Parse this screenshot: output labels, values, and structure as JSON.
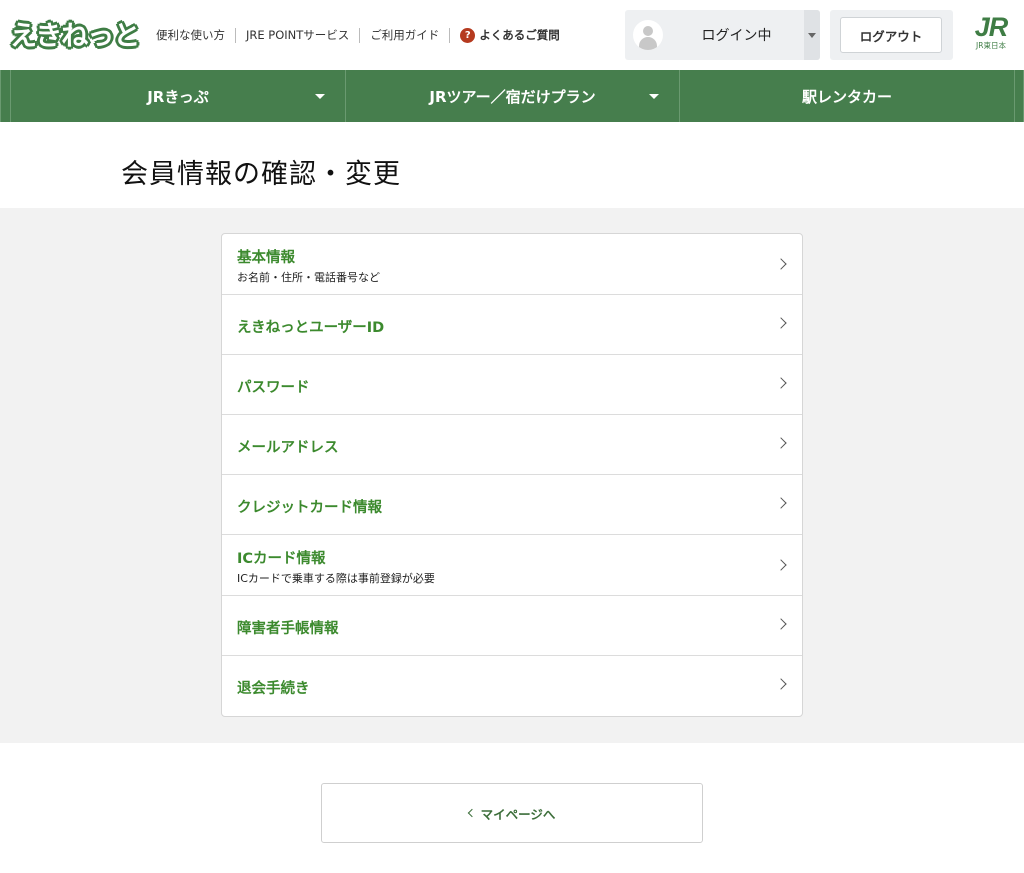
{
  "header": {
    "logo_text": "えきねっと",
    "links": [
      "便利な使い方",
      "JRE POINTサービス",
      "ご利用ガイド"
    ],
    "faq": {
      "icon": "question-icon",
      "label": "よくあるご質問"
    },
    "login_status": "ログイン中",
    "logout_label": "ログアウト",
    "jr_logo": {
      "mark": "JR",
      "caption": "JR東日本"
    }
  },
  "nav": {
    "items": [
      {
        "label": "JRきっぷ",
        "has_dropdown": true
      },
      {
        "label": "JRツアー／宿だけプラン",
        "has_dropdown": true
      },
      {
        "label": "駅レンタカー",
        "has_dropdown": false
      }
    ]
  },
  "page": {
    "title": "会員情報の確認・変更"
  },
  "menu": {
    "items": [
      {
        "label": "基本情報",
        "sub": "お名前・住所・電話番号など"
      },
      {
        "label": "えきねっとユーザーID",
        "sub": ""
      },
      {
        "label": "パスワード",
        "sub": ""
      },
      {
        "label": "メールアドレス",
        "sub": ""
      },
      {
        "label": "クレジットカード情報",
        "sub": ""
      },
      {
        "label": "ICカード情報",
        "sub": "ICカードで乗車する際は事前登録が必要"
      },
      {
        "label": "障害者手帳情報",
        "sub": ""
      },
      {
        "label": "退会手続き",
        "sub": ""
      }
    ]
  },
  "back_button": {
    "label": "マイページへ"
  },
  "colors": {
    "brand_green": "#467e4d",
    "link_green": "#3c8a2e",
    "section_gray": "#f2f2f2"
  }
}
